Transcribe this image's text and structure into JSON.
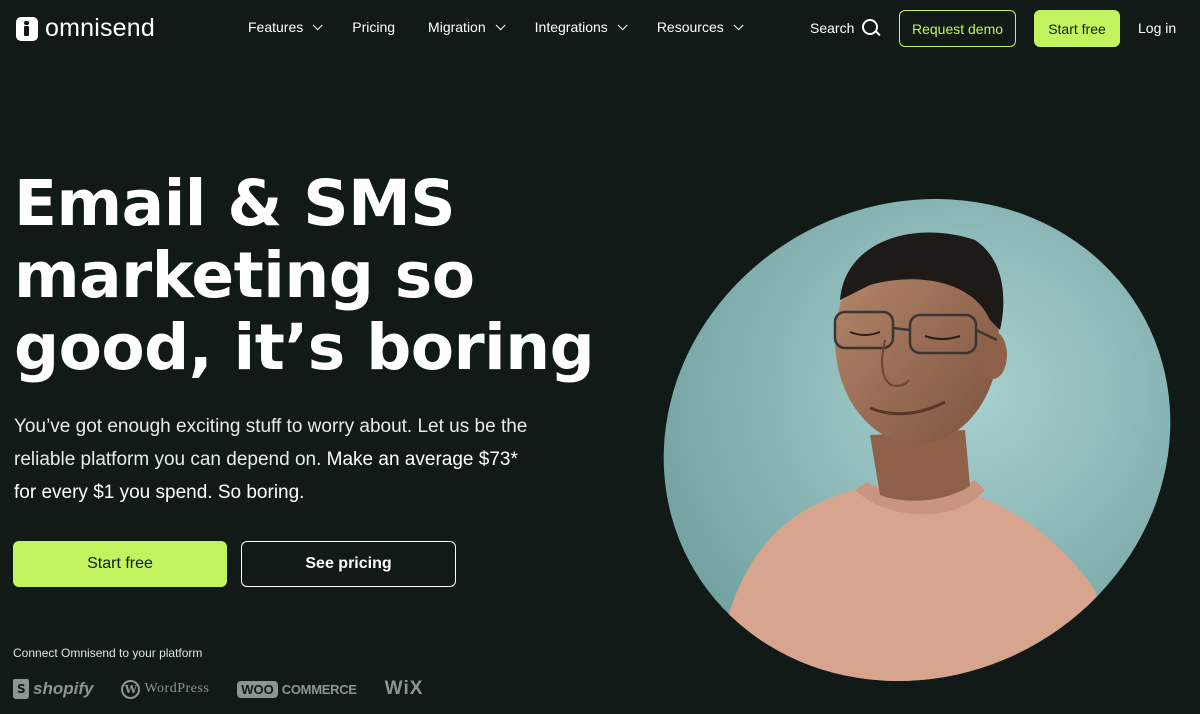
{
  "brand": {
    "name": "omnisend"
  },
  "nav": {
    "items": [
      {
        "label": "Features",
        "has_dropdown": true
      },
      {
        "label": "Pricing",
        "has_dropdown": false
      },
      {
        "label": "Migration",
        "has_dropdown": true
      },
      {
        "label": "Integrations",
        "has_dropdown": true
      },
      {
        "label": "Resources",
        "has_dropdown": true
      }
    ],
    "search_label": "Search",
    "request_demo_label": "Request demo",
    "start_free_label": "Start free",
    "login_label": "Log in"
  },
  "hero": {
    "headline_lines": [
      "Email & SMS",
      "marketing so",
      "good, it’s boring"
    ],
    "subtext_plain": "You’ve got enough exciting stuff to worry about. Let us be the reliable platform you can depend on. ",
    "subtext_emphasis": "Make an average $73* for every $1 you spend. So boring.",
    "primary_cta": "Start free",
    "secondary_cta": "See pricing",
    "connect_label": "Connect Omnisend to your platform",
    "platforms": {
      "shopify": "shopify",
      "wordpress": "WordPress",
      "woo_badge": "WOO",
      "woo_text": "COMMERCE",
      "wix": "WiX"
    }
  },
  "colors": {
    "background": "#111a17",
    "accent": "#c1f45f",
    "portrait_bg": "#8fbfbf",
    "sweater": "#d9a690"
  },
  "icons": {
    "logo": "omnisend-logo-icon",
    "search": "search-icon",
    "dropdown": "chevron-down-icon"
  }
}
